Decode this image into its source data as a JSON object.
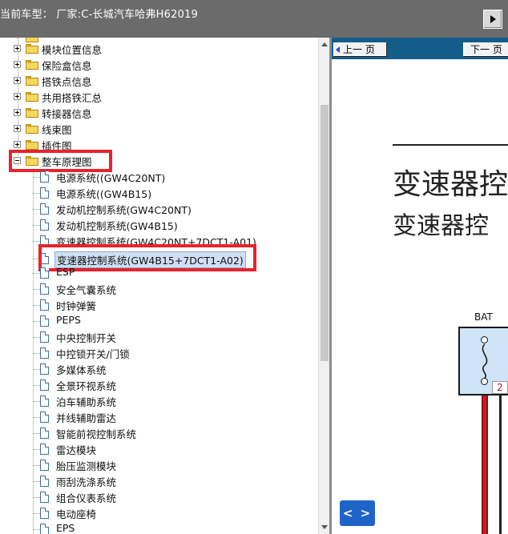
{
  "header": {
    "title": "当前车型： 厂家:C-长城汽车哈弗H62019"
  },
  "tree": {
    "folders": [
      {
        "label": "模块位置信息"
      },
      {
        "label": "保险盒信息"
      },
      {
        "label": "搭铁点信息"
      },
      {
        "label": "共用搭铁汇总"
      },
      {
        "label": "转接器信息"
      },
      {
        "label": "线束图"
      },
      {
        "label": "插件图"
      }
    ],
    "expanded_folder": {
      "label": "整车原理图"
    },
    "children": [
      {
        "label": "电源系统((GW4C20NT)"
      },
      {
        "label": "电源系统((GW4B15)"
      },
      {
        "label": "发动机控制系统(GW4C20NT)"
      },
      {
        "label": "发动机控制系统(GW4B15)"
      },
      {
        "label": "变速器控制系统(GW4C20NT+7DCT1-A01)"
      },
      {
        "label": "变速器控制系统(GW4B15+7DCT1-A02)"
      },
      {
        "label": "ESP"
      },
      {
        "label": "安全气囊系统"
      },
      {
        "label": "时钟弹簧"
      },
      {
        "label": "PEPS"
      },
      {
        "label": "中央控制开关"
      },
      {
        "label": "中控锁开关/门锁"
      },
      {
        "label": "多媒体系统"
      },
      {
        "label": "全景环视系统"
      },
      {
        "label": "泊车辅助系统"
      },
      {
        "label": "并线辅助雷达"
      },
      {
        "label": "智能前视控制系统"
      },
      {
        "label": "雷达模块"
      },
      {
        "label": "胎压监测模块"
      },
      {
        "label": "雨刮洗涤系统"
      },
      {
        "label": "组合仪表系统"
      },
      {
        "label": "电动座椅"
      },
      {
        "label": "EPS"
      }
    ]
  },
  "viewer": {
    "prev_label": "上一 页",
    "next_label": "下一 页",
    "title_line1": "变速器控",
    "title_line2": "变速器控",
    "bat_label": "BAT",
    "pin_number": "2",
    "toggle_label": "< >"
  },
  "colors": {
    "header_bg": "#6b6b6b",
    "viewer_bar": "#135e89",
    "highlight": "#e8232b",
    "wire": "#d11a26",
    "toggle_bg": "#1e64c8"
  }
}
